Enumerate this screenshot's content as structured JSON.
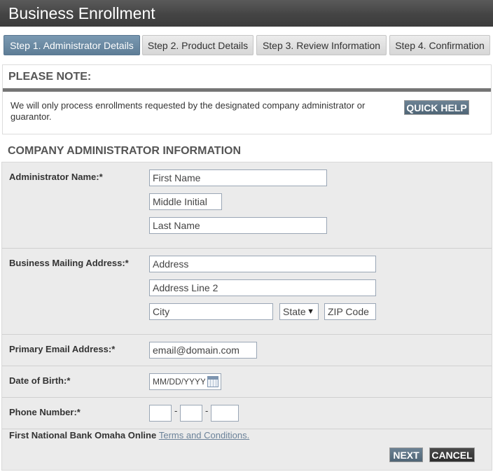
{
  "header": {
    "title": "Business Enrollment"
  },
  "steps": [
    {
      "label": "Step 1. Administrator Details",
      "active": true
    },
    {
      "label": "Step 2. Product Details",
      "active": false
    },
    {
      "label": "Step 3. Review Information",
      "active": false
    },
    {
      "label": "Step 4. Confirmation",
      "active": false
    }
  ],
  "note": {
    "title": "PLEASE NOTE:",
    "text": "We will only process enrollments requested by the designated company administrator or guarantor.",
    "quick_help_label": "QUICK HELP"
  },
  "section": {
    "title": "COMPANY ADMINISTRATOR INFORMATION"
  },
  "form": {
    "admin_name_label": "Administrator Name:*",
    "first_name_placeholder": "First Name",
    "middle_initial_placeholder": "Middle Initial",
    "last_name_placeholder": "Last Name",
    "address_label": "Business Mailing Address:*",
    "address_placeholder": "Address",
    "address2_placeholder": "Address Line 2",
    "city_placeholder": "City",
    "state_value": "State",
    "state_arrow": "▼",
    "zip_placeholder": "ZIP Code",
    "email_label": "Primary Email Address:*",
    "email_placeholder": "email@domain.com",
    "dob_label": "Date of Birth:*",
    "dob_placeholder": "MM/DD/YYYY",
    "phone_label": "Phone Number:*",
    "phone_separator": "-",
    "terms_prefix": "First National Bank Omaha Online",
    "terms_link": "Terms and Conditions."
  },
  "actions": {
    "next_label": "NEXT",
    "cancel_label": "CANCEL"
  },
  "colors": {
    "active_step": "#6a89a2",
    "header_bg": "#4a4a4a",
    "button_blue": "#5f7586"
  },
  "icons": {
    "calendar": "calendar-icon"
  }
}
